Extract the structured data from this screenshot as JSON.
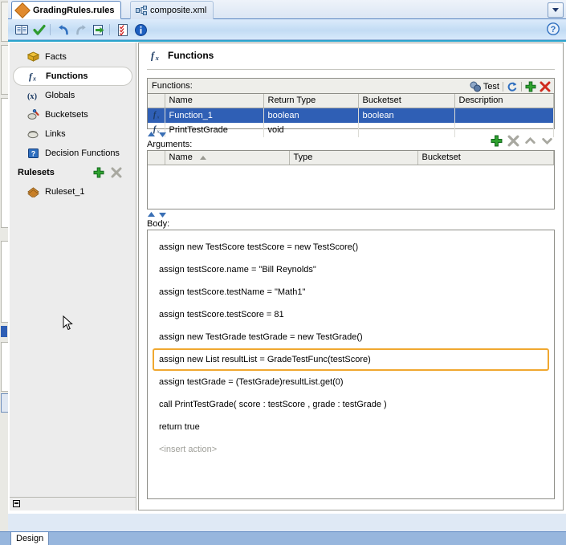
{
  "tabs": [
    {
      "label": "GradingRules.rules",
      "icon": "diamond-icon",
      "active": true
    },
    {
      "label": "composite.xml",
      "icon": "composite-icon",
      "active": false
    }
  ],
  "tab_overflow": {
    "name": "tabs-dropdown",
    "glyph": "▼"
  },
  "toolbar": {
    "buttons": [
      {
        "name": "dictionary-icon",
        "tooltip": "Dictionary"
      },
      {
        "name": "validate-check-icon",
        "tooltip": "Validate"
      },
      {
        "name": "undo-icon",
        "tooltip": "Undo"
      },
      {
        "name": "redo-icon",
        "tooltip": "Redo"
      },
      {
        "name": "export-icon",
        "tooltip": "Export"
      },
      {
        "name": "checklist-icon",
        "tooltip": "Test"
      },
      {
        "name": "info-icon",
        "tooltip": "Information"
      }
    ],
    "help_label": "?"
  },
  "navigator": {
    "items": [
      {
        "label": "Facts",
        "icon": "facts-icon",
        "selected": false
      },
      {
        "label": "Functions",
        "icon": "function-fx-icon",
        "selected": true
      },
      {
        "label": "Globals",
        "icon": "globals-x-icon",
        "selected": false
      },
      {
        "label": "Bucketsets",
        "icon": "bucketsets-icon",
        "selected": false
      },
      {
        "label": "Links",
        "icon": "links-icon",
        "selected": false
      },
      {
        "label": "Decision Functions",
        "icon": "decision-functions-icon",
        "selected": false
      }
    ],
    "rulesets_header": {
      "label": "Rulesets",
      "add_label": "+",
      "delete_label": "×"
    },
    "rulesets": [
      {
        "label": "Ruleset_1",
        "icon": "ruleset-icon"
      }
    ]
  },
  "editor": {
    "title": "Functions",
    "title_icon": "function-fx-icon",
    "functions_section": {
      "label": "Functions:",
      "label_mnemonic": "u",
      "test_label": "Test",
      "actions": [
        {
          "name": "test-button",
          "label": "Test"
        },
        {
          "name": "refresh-button",
          "label": ""
        },
        {
          "name": "add-function-button",
          "label": "+"
        },
        {
          "name": "delete-function-button",
          "label": "×"
        }
      ],
      "columns": [
        "Name",
        "Return Type",
        "Bucketset",
        "Description"
      ],
      "rows": [
        {
          "icon": "function-fx-icon",
          "name": "Function_1",
          "return_type": "boolean",
          "bucketset": "boolean",
          "description": "",
          "selected": true
        },
        {
          "icon": "function-fx-icon",
          "name": "PrintTestGrade",
          "return_type": "void",
          "bucketset": "",
          "description": "",
          "selected": false
        }
      ]
    },
    "arguments_section": {
      "label": "Arguments:",
      "label_mnemonic": "g",
      "actions": [
        {
          "name": "add-argument-button",
          "label": "+"
        },
        {
          "name": "delete-argument-button",
          "label": "×"
        },
        {
          "name": "move-argument-up-button",
          "label": "^"
        },
        {
          "name": "move-argument-down-button",
          "label": "v"
        }
      ],
      "columns": [
        "Name",
        "Type",
        "Bucketset"
      ],
      "sorted_column": "Name",
      "rows": []
    },
    "body_section": {
      "label": "Body:",
      "label_mnemonic": "y",
      "statements": [
        {
          "text": "assign new TestScore testScore = new TestScore()",
          "state": "normal"
        },
        {
          "text": "assign testScore.name = \"Bill Reynolds\"",
          "state": "normal"
        },
        {
          "text": "assign testScore.testName = \"Math1\"",
          "state": "normal"
        },
        {
          "text": "assign testScore.testScore = 81",
          "state": "normal"
        },
        {
          "text": "assign new TestGrade testGrade = new TestGrade()",
          "state": "normal"
        },
        {
          "text": "assign new List resultList = GradeTestFunc(testScore)",
          "state": "highlight"
        },
        {
          "text": "assign testGrade = (TestGrade)resultList.get(0)",
          "state": "normal"
        },
        {
          "text": "call PrintTestGrade( score : testScore , grade : testGrade )",
          "state": "normal"
        },
        {
          "text": "return true",
          "state": "normal"
        },
        {
          "text": "<insert action>",
          "state": "muted"
        }
      ]
    }
  },
  "bottom_bar": {
    "design_tab_label": "Design"
  },
  "colors": {
    "selection_blue": "#2f5fb5",
    "highlight_orange": "#f0a830",
    "accent_cyan": "#29a3cc",
    "status_bar_blue": "#97b6dd",
    "tab_orange_diamond": "#e08a2e"
  }
}
